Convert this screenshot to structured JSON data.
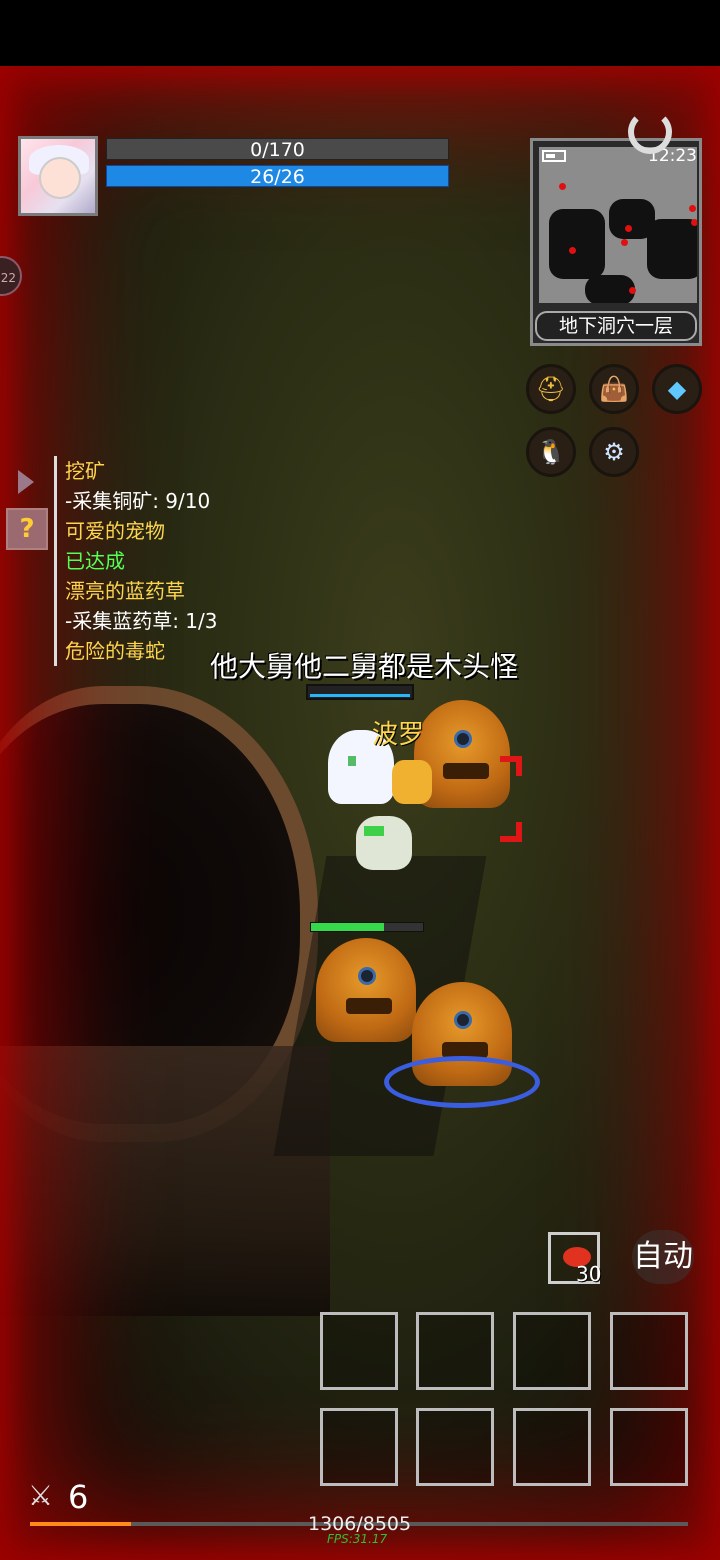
{
  "player": {
    "hp_text": "0/170",
    "mp_text": "26/26"
  },
  "minimap": {
    "location": "地下洞穴一层",
    "clock": "12:23"
  },
  "quests": [
    {
      "title": "挖矿",
      "sub": "-采集铜矿: 9/10"
    },
    {
      "title": "可爱的宠物",
      "status": "已达成"
    },
    {
      "title": "漂亮的蓝药草",
      "sub": "-采集蓝药草: 1/3"
    },
    {
      "title": "危险的毒蛇"
    }
  ],
  "scene": {
    "banner": "他大舅他二舅都是木头怪",
    "pet_name": "波罗",
    "enemy_hp_fraction": 0.65
  },
  "quick_item": {
    "count": "30",
    "icon": "meat-icon"
  },
  "auto_label": "自动",
  "level": "6",
  "xp": {
    "text": "1306/8505",
    "fraction": 0.1536
  },
  "fps": "FPS:31.17",
  "colors": {
    "mp_bar": "#1e88e5",
    "quest_title": "#ffd54f",
    "quest_done": "#55ff55",
    "xp_fill": "#ff8c1a"
  }
}
